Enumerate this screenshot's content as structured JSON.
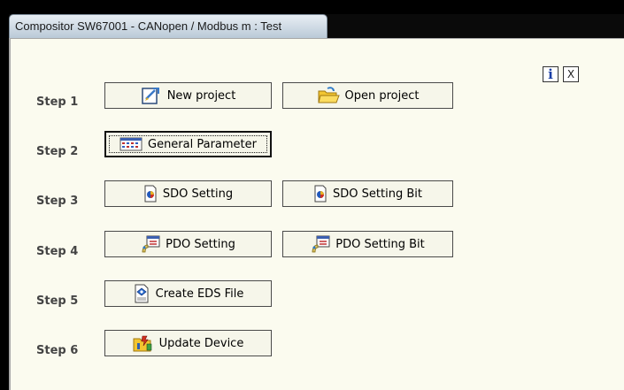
{
  "window": {
    "title": "Compositor SW67001 - CANopen / Modbus m : Test"
  },
  "header": {
    "info_label": "i",
    "close_label": "X"
  },
  "steps": [
    {
      "label": "Step 1"
    },
    {
      "label": "Step 2"
    },
    {
      "label": "Step 3"
    },
    {
      "label": "Step 4"
    },
    {
      "label": "Step 5"
    },
    {
      "label": "Step 6"
    }
  ],
  "buttons": {
    "new_project": "New project",
    "open_project": "Open project",
    "general_parameter": "General Parameter",
    "sdo_setting": "SDO Setting",
    "sdo_setting_bit": "SDO Setting Bit",
    "pdo_setting": "PDO Setting",
    "pdo_setting_bit": "PDO Setting Bit",
    "create_eds_file": "Create EDS File",
    "update_device": "Update Device"
  },
  "icons": {
    "new_project": "new-document-icon",
    "open_project": "open-folder-icon",
    "general_parameter": "parameter-table-icon",
    "sdo_setting": "sdo-icon",
    "sdo_setting_bit": "sdo-icon",
    "pdo_setting": "pdo-icon",
    "pdo_setting_bit": "pdo-icon",
    "create_eds_file": "eds-file-icon",
    "update_device": "update-device-icon"
  },
  "colors": {
    "client_background": "#fbfbef",
    "info_accent": "#1b3fa6"
  }
}
